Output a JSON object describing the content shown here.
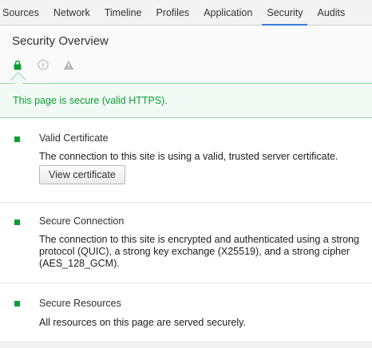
{
  "tabs": [
    {
      "label": "Sources",
      "active": false
    },
    {
      "label": "Network",
      "active": false
    },
    {
      "label": "Timeline",
      "active": false
    },
    {
      "label": "Profiles",
      "active": false
    },
    {
      "label": "Application",
      "active": false
    },
    {
      "label": "Security",
      "active": true
    },
    {
      "label": "Audits",
      "active": false
    }
  ],
  "overview": {
    "title": "Security Overview",
    "icons": [
      "lock-icon",
      "info-circle-icon",
      "warning-triangle-icon"
    ]
  },
  "banner": {
    "text": "This page is secure (valid HTTPS)."
  },
  "sections": [
    {
      "title": "Valid Certificate",
      "description": "The connection to this site is using a valid, trusted server certificate.",
      "button_label": "View certificate"
    },
    {
      "title": "Secure Connection",
      "description": "The connection to this site is encrypted and authenticated using a strong protocol (QUIC), a strong key exchange (X25519), and a strong cipher (AES_128_GCM)."
    },
    {
      "title": "Secure Resources",
      "description": "All resources on this page are served securely."
    }
  ],
  "colors": {
    "secure_green": "#0f9d34",
    "active_tab_underline": "#3e7bdc",
    "banner_background": "#f1faf4"
  }
}
